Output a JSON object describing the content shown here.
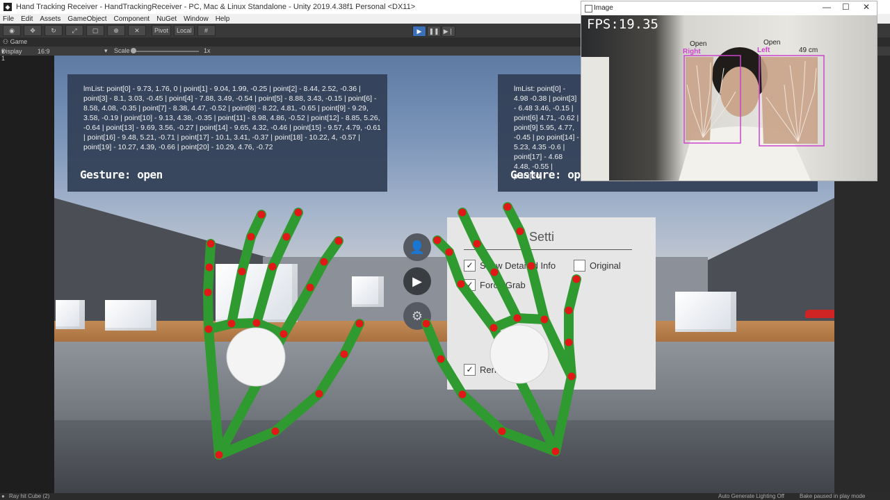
{
  "window": {
    "title": "Hand Tracking Receiver - HandTrackingReceiver - PC, Mac & Linux Standalone - Unity 2019.4.38f1 Personal <DX11>"
  },
  "menu": [
    "File",
    "Edit",
    "Assets",
    "GameObject",
    "Component",
    "NuGet",
    "Window",
    "Help"
  ],
  "toolbar": {
    "pivot_label": "Pivot",
    "local_label": "Local"
  },
  "game_tab": {
    "tab_label": "Game",
    "display_label": "Display 1",
    "aspect_label": "16:9",
    "scale_label": "Scale",
    "scale_value": "1x"
  },
  "left_panel": {
    "lmlist": "lmList: point[0] - 9.73, 1.76, 0 | point[1] - 9.04, 1.99, -0.25 | point[2] - 8.44, 2.52, -0.36 | point[3] - 8.1, 3.03, -0.45 | point[4] - 7.88, 3.49, -0.54 | point[5] - 8.88, 3.43, -0.15 | point[6] - 8.58, 4.08, -0.35 | point[7] - 8.38, 4.47, -0.52 | point[8] - 8.22, 4.81, -0.65 | point[9] - 9.29, 3.58, -0.19 | point[10] - 9.13, 4.38, -0.35 | point[11] - 8.98, 4.86, -0.52 | point[12] - 8.85, 5.26, -0.64 | point[13] - 9.69, 3.56, -0.27 | point[14] - 9.65, 4.32, -0.46 | point[15] - 9.57, 4.79, -0.61 | point[16] - 9.48, 5.21, -0.71 | point[17] - 10.1, 3.41, -0.37 | point[18] - 10.22, 4, -0.57 | point[19] - 10.27, 4.39, -0.66 | point[20] - 10.29, 4.76, -0.72",
    "gesture": "Gesture: open"
  },
  "right_panel": {
    "lmlist": "lmList: point[0] - 4.98 -0.38 | point[3] - 6.48 3.46, -0.15 | point[6] 4.71, -0.62 | point[9] 5.95, 4.77, -0.45 | po point[14] - 5.23, 4.35 -0.6 | point[17] - 4.68 4.48, -0.55 | point[20]",
    "gesture": "Gesture: open"
  },
  "settings": {
    "title": "Setti",
    "show_detailed_info": {
      "label": "Show Detailed Info",
      "checked": true
    },
    "original": {
      "label": "Original",
      "checked": false
    },
    "force_grab": {
      "label": "Force Grab",
      "checked": true
    },
    "render_line": {
      "label": "Render Line",
      "checked": true
    }
  },
  "side_buttons": {
    "user_icon": "user-icon",
    "play_icon": "play-icon",
    "gear_icon": "gear-icon"
  },
  "camera_window": {
    "title": "Image",
    "fps": "FPS:19.35",
    "right_hand_label": "Right",
    "right_hand_state": "Open",
    "left_hand_label": "Left",
    "left_hand_state": "Open",
    "distance": "49 cm"
  },
  "statusbar": {
    "left": "Ray hit Cube (2)",
    "lighting": "Auto Generate Lighting Off",
    "bake": "Bake paused in play mode"
  },
  "colors": {
    "hand_skeleton": "#2f9a2f",
    "joint": "#e01818",
    "panel_bg": "#313f56",
    "bbox": "#cc44cc"
  }
}
